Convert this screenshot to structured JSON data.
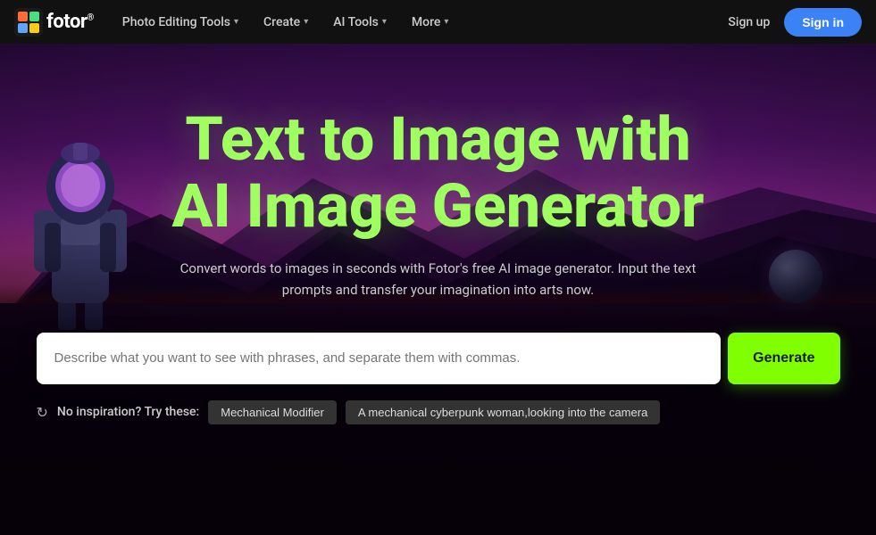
{
  "navbar": {
    "logo_text": "fotor",
    "logo_sup": "®",
    "nav_items": [
      {
        "id": "photo-editing",
        "label": "Photo Editing Tools",
        "has_chevron": true
      },
      {
        "id": "create",
        "label": "Create",
        "has_chevron": true
      },
      {
        "id": "ai-tools",
        "label": "AI Tools",
        "has_chevron": true
      },
      {
        "id": "more",
        "label": "More",
        "has_chevron": true
      }
    ],
    "signup_label": "Sign up",
    "signin_label": "Sign in"
  },
  "hero": {
    "title_line1": "Text to Image with",
    "title_line2": "AI Image Generator",
    "subtitle": "Convert words to images in seconds with Fotor's free AI image generator. Input the text prompts and transfer your imagination into arts now.",
    "input_placeholder": "Describe what you want to see with phrases, and separate them with commas.",
    "generate_label": "Generate",
    "inspiration_label": "No inspiration? Try these:",
    "tags": [
      {
        "id": "tag1",
        "label": "Mechanical Modifier"
      },
      {
        "id": "tag2",
        "label": "A mechanical cyberpunk woman,looking into the camera"
      }
    ]
  },
  "colors": {
    "accent_green": "#7fff00",
    "title_green": "#a0ff60",
    "signin_blue": "#3b82f6"
  }
}
